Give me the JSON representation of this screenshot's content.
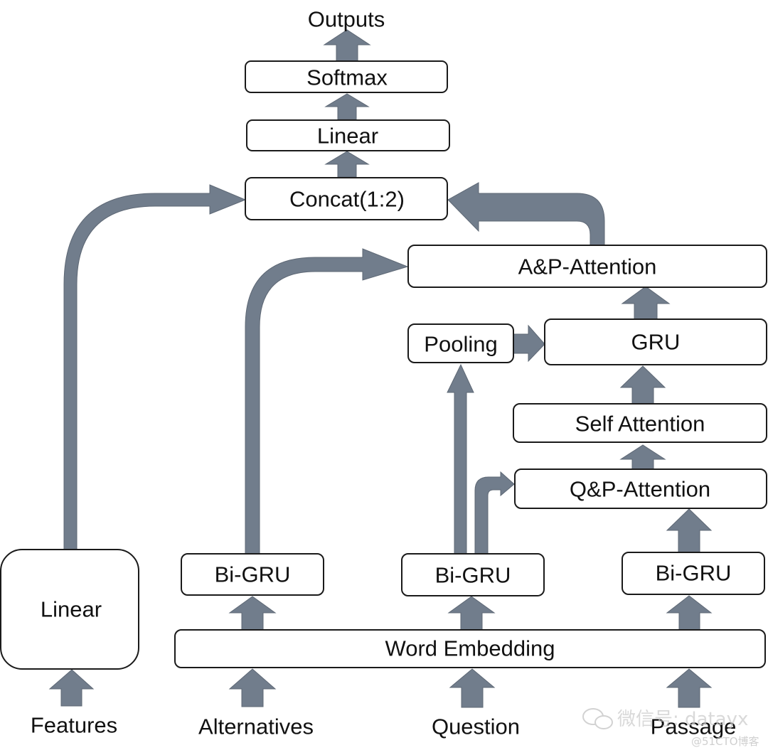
{
  "diagram": {
    "title": "Outputs",
    "arrow_color": "#717d8c",
    "nodes": {
      "softmax": "Softmax",
      "linear_top": "Linear",
      "concat": "Concat(1:2)",
      "ap_attention": "A&P-Attention",
      "pooling": "Pooling",
      "gru": "GRU",
      "self_attention": "Self Attention",
      "qp_attention": "Q&P-Attention",
      "bigru_alternatives": "Bi-GRU",
      "bigru_question": "Bi-GRU",
      "bigru_passage": "Bi-GRU",
      "linear_features": "Linear",
      "word_embedding": "Word Embedding"
    },
    "inputs": {
      "features": "Features",
      "alternatives": "Alternatives",
      "question": "Question",
      "passage": "Passage"
    },
    "watermark": {
      "wechat": "微信号: datayx",
      "site": "@51CTO博客"
    }
  }
}
